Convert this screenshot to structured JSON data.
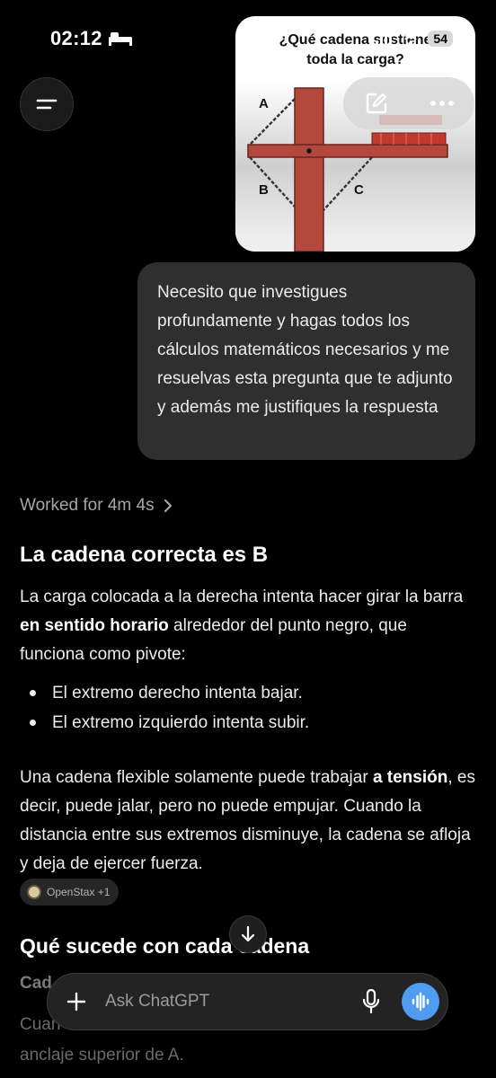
{
  "status_bar": {
    "time": "02:12",
    "battery": "54"
  },
  "attachment": {
    "title_line1": "¿Qué cadena sostiene",
    "title_line2": "toda la carga?",
    "label_a": "A",
    "label_b": "B",
    "label_c": "C"
  },
  "user_message": "Necesito que investigues profundamente y hagas todos los cálculos matemáticos necesarios y me resuelvas esta pregunta que te adjunto y además me justifiques la respuesta",
  "worked_for": "Worked for 4m 4s",
  "answer": {
    "heading": "La cadena correcta es B",
    "p1_a": "La carga colocada a la derecha intenta hacer girar la barra ",
    "p1_bold": "en sentido horario",
    "p1_b": " alrededor del punto negro, que funciona como pivote:",
    "bullets": [
      "El extremo derecho intenta bajar.",
      "El extremo izquierdo intenta subir."
    ],
    "p2_a": "Una cadena flexible solamente puede trabajar ",
    "p2_bold": "a tensión",
    "p2_b": ", es decir, puede jalar, pero no puede empujar. Cuando la distancia entre sus extremos disminuye, la cadena se afloja y deja de ejercer fuerza.",
    "citation": "OpenStax +1",
    "section_heading": "Qué sucede con cada cadena",
    "faded_heading": "Cad",
    "faded_text_a": "Cuan",
    "faded_text_b": "anclaje superior de A."
  },
  "composer": {
    "placeholder": "Ask ChatGPT"
  },
  "icons": {
    "menu": "menu-icon",
    "edit": "edit-icon",
    "more": "more-icon",
    "chevron": "chevron-right-icon",
    "arrow": "arrow-down-icon",
    "plus": "plus-icon",
    "mic": "mic-icon",
    "voice": "voice-wave-icon"
  },
  "colors": {
    "background": "#000000",
    "bubble": "#2f2f2f",
    "voice_button": "#4f9cf0",
    "beam": "#b5483c"
  }
}
